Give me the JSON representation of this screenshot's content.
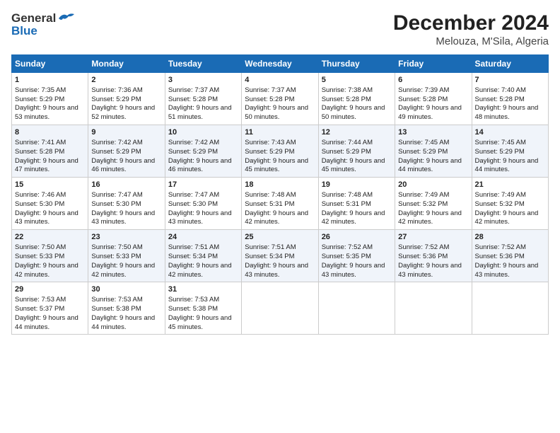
{
  "logo": {
    "general": "General",
    "blue": "Blue"
  },
  "title": "December 2024",
  "subtitle": "Melouza, M'Sila, Algeria",
  "days_of_week": [
    "Sunday",
    "Monday",
    "Tuesday",
    "Wednesday",
    "Thursday",
    "Friday",
    "Saturday"
  ],
  "weeks": [
    [
      {
        "day": "1",
        "sunrise": "Sunrise: 7:35 AM",
        "sunset": "Sunset: 5:29 PM",
        "daylight": "Daylight: 9 hours and 53 minutes."
      },
      {
        "day": "2",
        "sunrise": "Sunrise: 7:36 AM",
        "sunset": "Sunset: 5:29 PM",
        "daylight": "Daylight: 9 hours and 52 minutes."
      },
      {
        "day": "3",
        "sunrise": "Sunrise: 7:37 AM",
        "sunset": "Sunset: 5:28 PM",
        "daylight": "Daylight: 9 hours and 51 minutes."
      },
      {
        "day": "4",
        "sunrise": "Sunrise: 7:37 AM",
        "sunset": "Sunset: 5:28 PM",
        "daylight": "Daylight: 9 hours and 50 minutes."
      },
      {
        "day": "5",
        "sunrise": "Sunrise: 7:38 AM",
        "sunset": "Sunset: 5:28 PM",
        "daylight": "Daylight: 9 hours and 50 minutes."
      },
      {
        "day": "6",
        "sunrise": "Sunrise: 7:39 AM",
        "sunset": "Sunset: 5:28 PM",
        "daylight": "Daylight: 9 hours and 49 minutes."
      },
      {
        "day": "7",
        "sunrise": "Sunrise: 7:40 AM",
        "sunset": "Sunset: 5:28 PM",
        "daylight": "Daylight: 9 hours and 48 minutes."
      }
    ],
    [
      {
        "day": "8",
        "sunrise": "Sunrise: 7:41 AM",
        "sunset": "Sunset: 5:28 PM",
        "daylight": "Daylight: 9 hours and 47 minutes."
      },
      {
        "day": "9",
        "sunrise": "Sunrise: 7:42 AM",
        "sunset": "Sunset: 5:29 PM",
        "daylight": "Daylight: 9 hours and 46 minutes."
      },
      {
        "day": "10",
        "sunrise": "Sunrise: 7:42 AM",
        "sunset": "Sunset: 5:29 PM",
        "daylight": "Daylight: 9 hours and 46 minutes."
      },
      {
        "day": "11",
        "sunrise": "Sunrise: 7:43 AM",
        "sunset": "Sunset: 5:29 PM",
        "daylight": "Daylight: 9 hours and 45 minutes."
      },
      {
        "day": "12",
        "sunrise": "Sunrise: 7:44 AM",
        "sunset": "Sunset: 5:29 PM",
        "daylight": "Daylight: 9 hours and 45 minutes."
      },
      {
        "day": "13",
        "sunrise": "Sunrise: 7:45 AM",
        "sunset": "Sunset: 5:29 PM",
        "daylight": "Daylight: 9 hours and 44 minutes."
      },
      {
        "day": "14",
        "sunrise": "Sunrise: 7:45 AM",
        "sunset": "Sunset: 5:29 PM",
        "daylight": "Daylight: 9 hours and 44 minutes."
      }
    ],
    [
      {
        "day": "15",
        "sunrise": "Sunrise: 7:46 AM",
        "sunset": "Sunset: 5:30 PM",
        "daylight": "Daylight: 9 hours and 43 minutes."
      },
      {
        "day": "16",
        "sunrise": "Sunrise: 7:47 AM",
        "sunset": "Sunset: 5:30 PM",
        "daylight": "Daylight: 9 hours and 43 minutes."
      },
      {
        "day": "17",
        "sunrise": "Sunrise: 7:47 AM",
        "sunset": "Sunset: 5:30 PM",
        "daylight": "Daylight: 9 hours and 43 minutes."
      },
      {
        "day": "18",
        "sunrise": "Sunrise: 7:48 AM",
        "sunset": "Sunset: 5:31 PM",
        "daylight": "Daylight: 9 hours and 42 minutes."
      },
      {
        "day": "19",
        "sunrise": "Sunrise: 7:48 AM",
        "sunset": "Sunset: 5:31 PM",
        "daylight": "Daylight: 9 hours and 42 minutes."
      },
      {
        "day": "20",
        "sunrise": "Sunrise: 7:49 AM",
        "sunset": "Sunset: 5:32 PM",
        "daylight": "Daylight: 9 hours and 42 minutes."
      },
      {
        "day": "21",
        "sunrise": "Sunrise: 7:49 AM",
        "sunset": "Sunset: 5:32 PM",
        "daylight": "Daylight: 9 hours and 42 minutes."
      }
    ],
    [
      {
        "day": "22",
        "sunrise": "Sunrise: 7:50 AM",
        "sunset": "Sunset: 5:33 PM",
        "daylight": "Daylight: 9 hours and 42 minutes."
      },
      {
        "day": "23",
        "sunrise": "Sunrise: 7:50 AM",
        "sunset": "Sunset: 5:33 PM",
        "daylight": "Daylight: 9 hours and 42 minutes."
      },
      {
        "day": "24",
        "sunrise": "Sunrise: 7:51 AM",
        "sunset": "Sunset: 5:34 PM",
        "daylight": "Daylight: 9 hours and 42 minutes."
      },
      {
        "day": "25",
        "sunrise": "Sunrise: 7:51 AM",
        "sunset": "Sunset: 5:34 PM",
        "daylight": "Daylight: 9 hours and 43 minutes."
      },
      {
        "day": "26",
        "sunrise": "Sunrise: 7:52 AM",
        "sunset": "Sunset: 5:35 PM",
        "daylight": "Daylight: 9 hours and 43 minutes."
      },
      {
        "day": "27",
        "sunrise": "Sunrise: 7:52 AM",
        "sunset": "Sunset: 5:36 PM",
        "daylight": "Daylight: 9 hours and 43 minutes."
      },
      {
        "day": "28",
        "sunrise": "Sunrise: 7:52 AM",
        "sunset": "Sunset: 5:36 PM",
        "daylight": "Daylight: 9 hours and 43 minutes."
      }
    ],
    [
      {
        "day": "29",
        "sunrise": "Sunrise: 7:53 AM",
        "sunset": "Sunset: 5:37 PM",
        "daylight": "Daylight: 9 hours and 44 minutes."
      },
      {
        "day": "30",
        "sunrise": "Sunrise: 7:53 AM",
        "sunset": "Sunset: 5:38 PM",
        "daylight": "Daylight: 9 hours and 44 minutes."
      },
      {
        "day": "31",
        "sunrise": "Sunrise: 7:53 AM",
        "sunset": "Sunset: 5:38 PM",
        "daylight": "Daylight: 9 hours and 45 minutes."
      },
      null,
      null,
      null,
      null
    ]
  ]
}
